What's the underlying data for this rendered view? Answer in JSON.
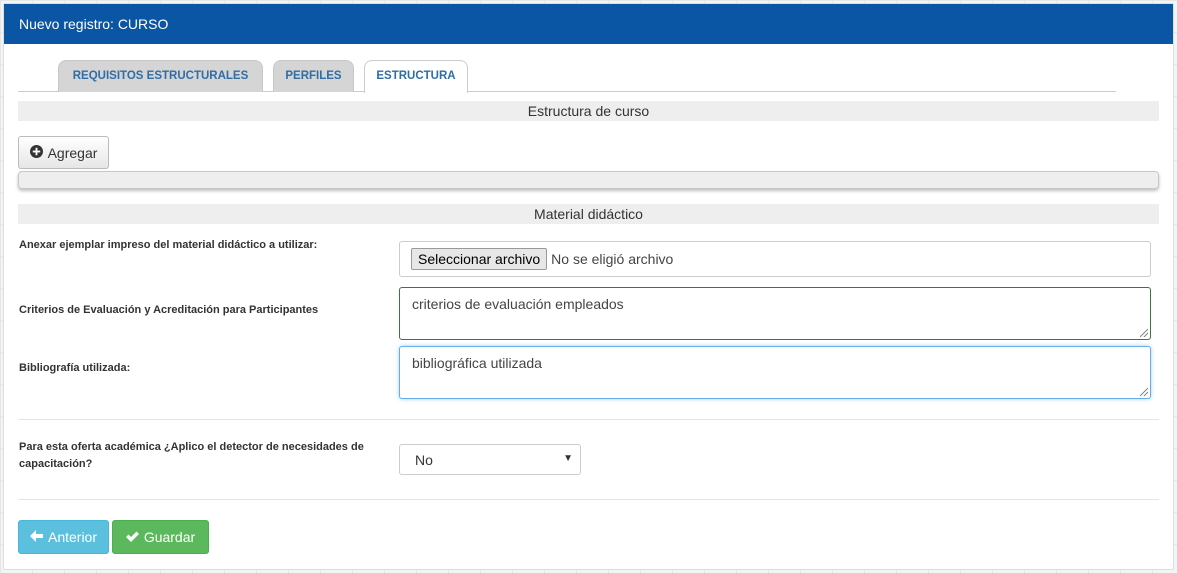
{
  "window": {
    "title": "Nuevo registro: CURSO"
  },
  "tabs": [
    {
      "label": "REQUISITOS ESTRUCTURALES",
      "active": false
    },
    {
      "label": "PERFILES",
      "active": false
    },
    {
      "label": "ESTRUCTURA",
      "active": true
    }
  ],
  "sections": {
    "estructura": "Estructura de curso",
    "material": "Material didáctico"
  },
  "buttons": {
    "agregar": "Agregar",
    "anterior": "Anterior",
    "guardar": "Guardar"
  },
  "form": {
    "anexar_label": "Anexar ejemplar impreso del material didáctico a utilizar:",
    "file_button": "Seleccionar archivo",
    "file_status": "No se eligió archivo",
    "criterios_label": "Criterios de Evaluación y Acreditación para Participantes",
    "criterios_value": "criterios de evaluación empleados",
    "bibliografia_label": "Bibliografía utilizada:",
    "bibliografia_value": "bibliográfica utilizada",
    "detector_label": "Para esta oferta académica ¿Aplico el detector de necesidades de capacitación?",
    "detector_value": "No"
  },
  "icons": {
    "agregar": "plus-circle-icon",
    "anterior": "arrow-left-icon",
    "guardar": "check-icon",
    "select": "caret-down-icon"
  },
  "colors": {
    "header": "#0a56a5",
    "tab_text": "#2f6da7",
    "info": "#5bc0de",
    "success": "#5cb85c"
  }
}
